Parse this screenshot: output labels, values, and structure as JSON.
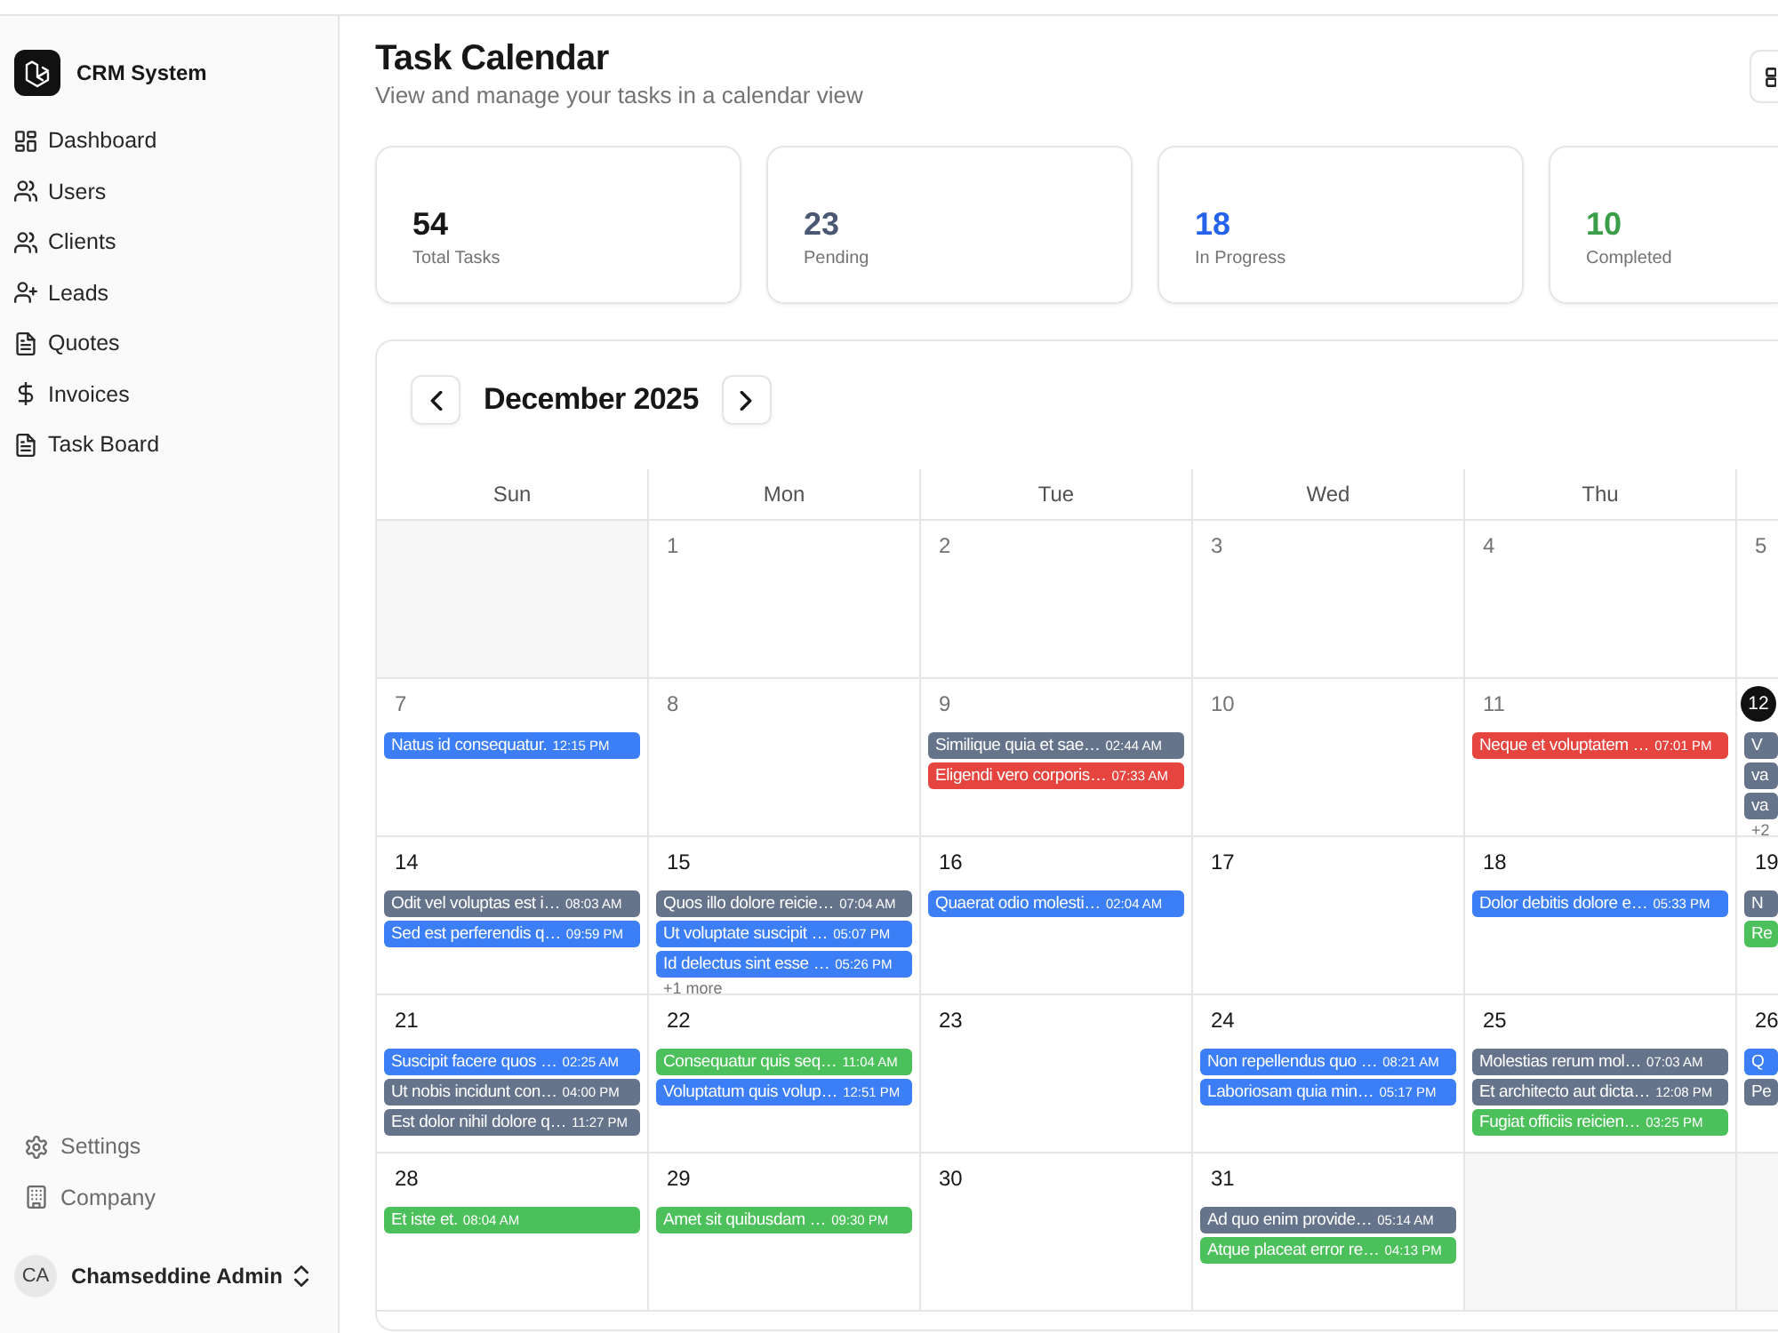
{
  "sidebar": {
    "brand": "CRM System",
    "nav": [
      "Dashboard",
      "Users",
      "Clients",
      "Leads",
      "Quotes",
      "Invoices",
      "Task Board"
    ],
    "footer_nav": [
      "Settings",
      "Company"
    ],
    "user": {
      "initials": "CA",
      "name": "Chamseddine Admin"
    }
  },
  "header": {
    "title": "Task Calendar",
    "subtitle": "View and manage your tasks in a calendar view"
  },
  "stats": [
    {
      "value": "54",
      "label": "Total Tasks",
      "color": "#171717"
    },
    {
      "value": "23",
      "label": "Pending",
      "color": "#4b5874"
    },
    {
      "value": "18",
      "label": "In Progress",
      "color": "#2563eb"
    },
    {
      "value": "10",
      "label": "Completed",
      "color": "#3a9d48"
    }
  ],
  "calendar": {
    "month": "December 2025",
    "weekdays": [
      "Sun",
      "Mon",
      "Tue",
      "Wed",
      "Thu"
    ],
    "weeks": [
      {
        "days": [
          {
            "kind": "blank"
          },
          {
            "kind": "day",
            "day": "1",
            "past": true,
            "today": false
          },
          {
            "kind": "day",
            "day": "2",
            "past": true,
            "today": false
          },
          {
            "kind": "day",
            "day": "3",
            "past": true,
            "today": false
          },
          {
            "kind": "day",
            "day": "4",
            "past": true,
            "today": false
          },
          {
            "kind": "day",
            "day": "5",
            "past": true,
            "today": false
          }
        ]
      },
      {
        "days": [
          {
            "kind": "day",
            "day": "7",
            "past": true,
            "today": false,
            "events": [
              {
                "title": "Natus id consequatur.",
                "time": "12:15 PM",
                "color": "#3b7ef6"
              }
            ]
          },
          {
            "kind": "day",
            "day": "8",
            "past": true,
            "today": false
          },
          {
            "kind": "day",
            "day": "9",
            "past": true,
            "today": false,
            "events": [
              {
                "title": "Similique quia et sae…",
                "time": "02:44 AM",
                "color": "#66748b"
              },
              {
                "title": "Eligendi vero corporis…",
                "time": "07:33 AM",
                "color": "#e5443f"
              }
            ]
          },
          {
            "kind": "day",
            "day": "10",
            "past": true,
            "today": false
          },
          {
            "kind": "day",
            "day": "11",
            "past": true,
            "today": false,
            "events": [
              {
                "title": "Neque et voluptatem …",
                "time": "07:01 PM",
                "color": "#e5443f"
              }
            ]
          },
          {
            "kind": "day",
            "day": "12",
            "past": false,
            "today": true,
            "events": [
              {
                "title": "V",
                "color": "#66748b"
              },
              {
                "title": "va",
                "color": "#66748b"
              },
              {
                "title": "va",
                "color": "#66748b"
              }
            ],
            "more": "+2"
          }
        ]
      },
      {
        "days": [
          {
            "kind": "day",
            "day": "14",
            "past": false,
            "today": false,
            "events": [
              {
                "title": "Odit vel voluptas est i…",
                "time": "08:03 AM",
                "color": "#66748b"
              },
              {
                "title": "Sed est perferendis q…",
                "time": "09:59 PM",
                "color": "#3b7ef6"
              }
            ]
          },
          {
            "kind": "day",
            "day": "15",
            "past": false,
            "today": false,
            "events": [
              {
                "title": "Quos illo dolore reicie…",
                "time": "07:04 AM",
                "color": "#66748b"
              },
              {
                "title": "Ut voluptate suscipit …",
                "time": "05:07 PM",
                "color": "#3b7ef6"
              },
              {
                "title": "Id delectus sint esse …",
                "time": "05:26 PM",
                "color": "#3b7ef6"
              }
            ],
            "more": "+1 more"
          },
          {
            "kind": "day",
            "day": "16",
            "past": false,
            "today": false,
            "events": [
              {
                "title": "Quaerat odio molesti…",
                "time": "02:04 AM",
                "color": "#3b7ef6"
              }
            ]
          },
          {
            "kind": "day",
            "day": "17",
            "past": false,
            "today": false
          },
          {
            "kind": "day",
            "day": "18",
            "past": false,
            "today": false,
            "events": [
              {
                "title": "Dolor debitis dolore e…",
                "time": "05:33 PM",
                "color": "#3b7ef6"
              }
            ]
          },
          {
            "kind": "day",
            "day": "19",
            "past": false,
            "today": false,
            "events": [
              {
                "title": "N",
                "color": "#66748b"
              },
              {
                "title": "Re",
                "color": "#4cc15b"
              }
            ]
          }
        ]
      },
      {
        "days": [
          {
            "kind": "day",
            "day": "21",
            "past": false,
            "today": false,
            "events": [
              {
                "title": "Suscipit facere quos …",
                "time": "02:25 AM",
                "color": "#3b7ef6"
              },
              {
                "title": "Ut nobis incidunt con…",
                "time": "04:00 PM",
                "color": "#66748b"
              },
              {
                "title": "Est dolor nihil dolore q…",
                "time": "11:27 PM",
                "color": "#66748b"
              }
            ]
          },
          {
            "kind": "day",
            "day": "22",
            "past": false,
            "today": false,
            "events": [
              {
                "title": "Consequatur quis seq…",
                "time": "11:04 AM",
                "color": "#4cc15b"
              },
              {
                "title": "Voluptatum quis volup…",
                "time": "12:51 PM",
                "color": "#3b7ef6"
              }
            ]
          },
          {
            "kind": "day",
            "day": "23",
            "past": false,
            "today": false
          },
          {
            "kind": "day",
            "day": "24",
            "past": false,
            "today": false,
            "events": [
              {
                "title": "Non repellendus quo …",
                "time": "08:21 AM",
                "color": "#3b7ef6"
              },
              {
                "title": "Laboriosam quia min…",
                "time": "05:17 PM",
                "color": "#3b7ef6"
              }
            ]
          },
          {
            "kind": "day",
            "day": "25",
            "past": false,
            "today": false,
            "events": [
              {
                "title": "Molestias rerum mol…",
                "time": "07:03 AM",
                "color": "#66748b"
              },
              {
                "title": "Et architecto aut dicta…",
                "time": "12:08 PM",
                "color": "#66748b"
              },
              {
                "title": "Fugiat officiis reicien…",
                "time": "03:25 PM",
                "color": "#4cc15b"
              }
            ]
          },
          {
            "kind": "day",
            "day": "26",
            "past": false,
            "today": false,
            "events": [
              {
                "title": "Q",
                "color": "#3b7ef6"
              },
              {
                "title": "Pe",
                "color": "#66748b"
              }
            ]
          }
        ]
      },
      {
        "days": [
          {
            "kind": "day",
            "day": "28",
            "past": false,
            "today": false,
            "events": [
              {
                "title": "Et iste et.",
                "time": "08:04 AM",
                "color": "#4cc15b"
              }
            ]
          },
          {
            "kind": "day",
            "day": "29",
            "past": false,
            "today": false,
            "events": [
              {
                "title": "Amet sit quibusdam …",
                "time": "09:30 PM",
                "color": "#4cc15b"
              }
            ]
          },
          {
            "kind": "day",
            "day": "30",
            "past": false,
            "today": false
          },
          {
            "kind": "day",
            "day": "31",
            "past": false,
            "today": false,
            "events": [
              {
                "title": "Ad quo enim provide…",
                "time": "05:14 AM",
                "color": "#66748b"
              },
              {
                "title": "Atque placeat error re…",
                "time": "04:13 PM",
                "color": "#4cc15b"
              }
            ]
          },
          {
            "kind": "blank"
          },
          {
            "kind": "blank"
          }
        ]
      }
    ]
  }
}
